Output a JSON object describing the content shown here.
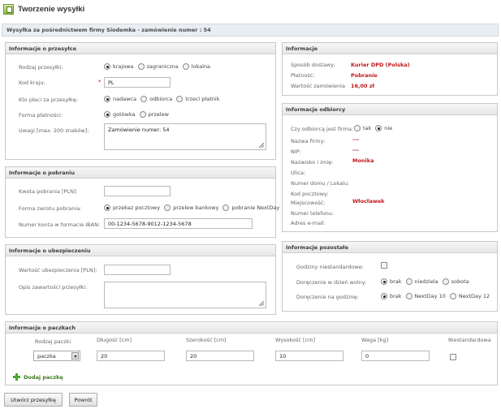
{
  "app": {
    "title": "Tworzenie wysyłki"
  },
  "subtitle": "Wysyłka za pośrednictwem firmy Siodemka - zamówienie numer : 54",
  "package_info": {
    "header": "Informacje o przesyłce",
    "type_label": "Rodzaj przesyłki:",
    "type_options": [
      "krajowa",
      "zagraniczna",
      "lokalna"
    ],
    "type_selected": "krajowa",
    "country_label": "Kod kraju:",
    "country_required": "*",
    "country_value": "PL",
    "payer_label": "Kto płaci za przesyłkę:",
    "payer_options": [
      "nadawca",
      "odbiorca",
      "trzeci płatnik"
    ],
    "payer_selected": "nadawca",
    "payment_label": "Forma płatności:",
    "payment_options": [
      "gotówka",
      "przelew"
    ],
    "payment_selected": "gotówka",
    "notes_label": "Uwagi [max. 200 znaków]:",
    "notes_value": "Zamówienie numer: 54"
  },
  "cod_info": {
    "header": "Informacje o pobraniu",
    "amount_label": "Kwota pobrania [PLN]:",
    "amount_value": "",
    "return_label": "Forma zwrotu pobrania:",
    "return_options": [
      "przekaz pocztowy",
      "przelew bankowy",
      "pobranie NextDay"
    ],
    "return_selected": "przekaz pocztowy",
    "iban_label": "Numer konta w formacie IBAN:",
    "iban_value": "00-1234-5678-9012-1234-5678"
  },
  "insurance_info": {
    "header": "Informacje o ubezpieczeniu",
    "value_label": "Wartość ubezpieczenia [PLN]:",
    "value_value": "",
    "desc_label": "Opis zawartości przesyłki:",
    "desc_value": ""
  },
  "info": {
    "header": "Informacje",
    "rows": [
      {
        "label": "Sposób dostawy:",
        "value": "Kurier DPD (Polska)"
      },
      {
        "label": "Płatność:",
        "value": "Pobranie"
      },
      {
        "label": "Wartość zamówienia",
        "value": "16,00 zł"
      }
    ]
  },
  "recipient": {
    "header": "Informacje odbiorcy",
    "is_company_label": "Czy odbiorcą jest firma:",
    "is_company_options": [
      "tak",
      "nie"
    ],
    "is_company_selected": "nie",
    "rows": [
      {
        "label": "Nazwa firmy:",
        "value": "---"
      },
      {
        "label": "NIP:",
        "value": "---"
      },
      {
        "label": "Nazwisko i imię:",
        "value": "Monika"
      },
      {
        "label": "Ulica:",
        "value": ""
      },
      {
        "label": "Numer domu / Lokalu:",
        "value": ""
      },
      {
        "label": "Kod pocztowy:",
        "value": ""
      },
      {
        "label": "Miejscowość:",
        "value": "Włocławek"
      },
      {
        "label": "Numer telefonu:",
        "value": ""
      },
      {
        "label": "Adres e-mail:",
        "value": ""
      }
    ]
  },
  "other_info": {
    "header": "Informacje pozostałe",
    "nonstandard_hours_label": "Godziny niestandardowe:",
    "day_off_label": "Doręczenie w dzień wolny:",
    "day_off_options": [
      "brak",
      "niedziela",
      "sobota"
    ],
    "day_off_selected": "brak",
    "hour_label": "Doręczenie na godzinę:",
    "hour_options": [
      "brak",
      "NextDay 10",
      "NextDay 12"
    ],
    "hour_selected": "brak"
  },
  "parcels": {
    "header": "Informacje o paczkach",
    "columns": [
      "Rodzaj paczki",
      "Długość [cm]",
      "Szerokość [cm]",
      "Wysokość [cm]",
      "Waga [kg]",
      "Niestandardowa"
    ],
    "row": {
      "type": "paczka",
      "length": "20",
      "width": "20",
      "height": "10",
      "weight": "0"
    },
    "add_label": "Dodaj paczkę"
  },
  "buttons": {
    "create": "Utwórz przesyłkę",
    "back": "Powrót"
  },
  "colors": {
    "accent_red": "#c0161a",
    "add_green": "#4ca630",
    "subtitle_bg": "#e9eef2"
  }
}
